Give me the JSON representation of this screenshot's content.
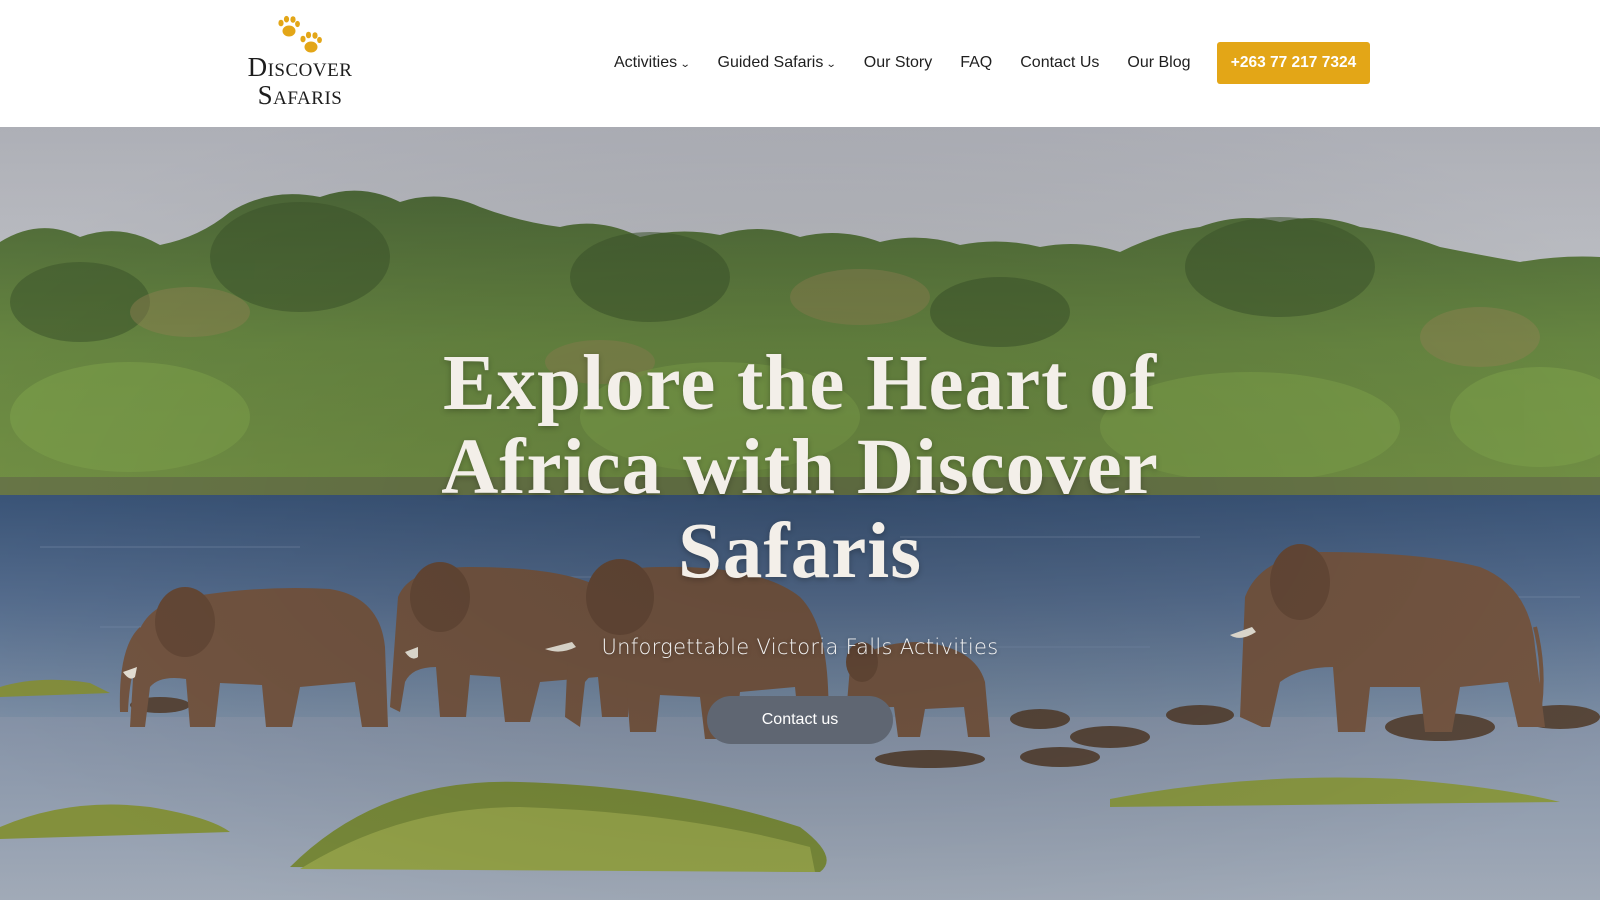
{
  "header": {
    "logo": {
      "line1": "Discover",
      "line2": "Safaris",
      "icon": "paw-prints-icon",
      "accent_color": "#e3a617"
    },
    "nav": [
      {
        "label": "Activities",
        "has_dropdown": true
      },
      {
        "label": "Guided Safaris",
        "has_dropdown": true
      },
      {
        "label": "Our Story",
        "has_dropdown": false
      },
      {
        "label": "FAQ",
        "has_dropdown": false
      },
      {
        "label": "Contact Us",
        "has_dropdown": false
      },
      {
        "label": "Our Blog",
        "has_dropdown": false
      }
    ],
    "dropdown_glyph": "⌄",
    "phone_button": {
      "label": "+263 77 217 7324",
      "color": "#e3a617"
    }
  },
  "hero": {
    "title": "Explore the Heart of Africa with Discover Safaris",
    "subtitle": "Unforgettable Victoria Falls Activities",
    "cta_label": "Contact us",
    "cta_color": "#5f6672"
  }
}
